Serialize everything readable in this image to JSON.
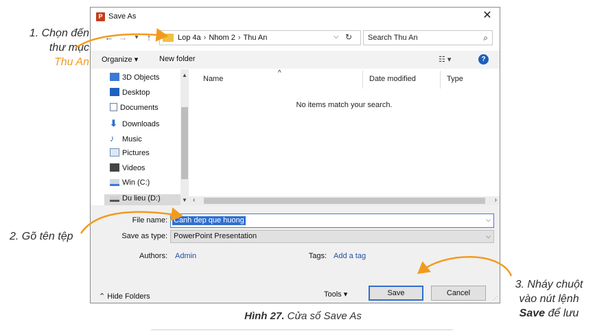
{
  "dialog": {
    "title": "Save As",
    "app_icon_letter": "P",
    "close_glyph": "✕",
    "nav": {
      "back": "←",
      "forward": "→",
      "recent": "▾",
      "up": "↑"
    },
    "breadcrumbs": [
      "Lop 4a",
      "Nhom 2",
      "Thu An"
    ],
    "address_dropdown": "⌵",
    "refresh_glyph": "↻",
    "search_placeholder": "Search Thu An",
    "search_glyph": "⌕",
    "toolbar": {
      "organize": "Organize ▾",
      "new_folder": "New folder",
      "view": "☷ ▾",
      "help": "?"
    },
    "nav_items": [
      {
        "label": "3D Objects",
        "icon": "cube-icon",
        "color": "#3a7bd5"
      },
      {
        "label": "Desktop",
        "icon": "desktop-icon",
        "color": "#2060c0"
      },
      {
        "label": "Documents",
        "icon": "document-icon",
        "color": "#6a7d9a"
      },
      {
        "label": "Downloads",
        "icon": "download-icon",
        "color": "#2a6fd6"
      },
      {
        "label": "Music",
        "icon": "music-icon",
        "color": "#2a6fd6"
      },
      {
        "label": "Pictures",
        "icon": "picture-icon",
        "color": "#6a8fb8"
      },
      {
        "label": "Videos",
        "icon": "video-icon",
        "color": "#444444"
      },
      {
        "label": "Win (C:)",
        "icon": "drive-icon",
        "color": "#3a7bd5"
      },
      {
        "label": "Du lieu (D:)",
        "icon": "drive-icon",
        "color": "#555555"
      }
    ],
    "columns": {
      "name": "Name",
      "date_modified": "Date modified",
      "type": "Type",
      "sort_glyph": "^"
    },
    "empty_message": "No items match your search.",
    "file_name_label": "File name:",
    "file_name_value": "Canh dep que huong",
    "save_as_type_label": "Save as type:",
    "save_as_type_value": "PowerPoint Presentation",
    "authors_label": "Authors:",
    "authors_value": "Admin",
    "tags_label": "Tags:",
    "tags_value": "Add a tag",
    "hide_folders": "⌃ Hide Folders",
    "tools": "Tools   ▾",
    "save_button": "Save",
    "cancel_button": "Cancel"
  },
  "annotations": {
    "step1_a": "1. Chọn đến",
    "step1_b": "thư mục",
    "step1_c": "Thu An",
    "step2": "2. Gõ tên tệp",
    "step3_a": "3. Nháy chuột",
    "step3_b": "vào nút lệnh",
    "step3_c_bold": "Save",
    "step3_c_rest": " để lưu"
  },
  "caption": {
    "bold": "Hình 27.",
    "rest": " Cửa sổ Save As"
  },
  "colors": {
    "accent_orange": "#f39a1e",
    "selection_blue": "#2f6fd0",
    "link_blue": "#1f4f9f"
  }
}
